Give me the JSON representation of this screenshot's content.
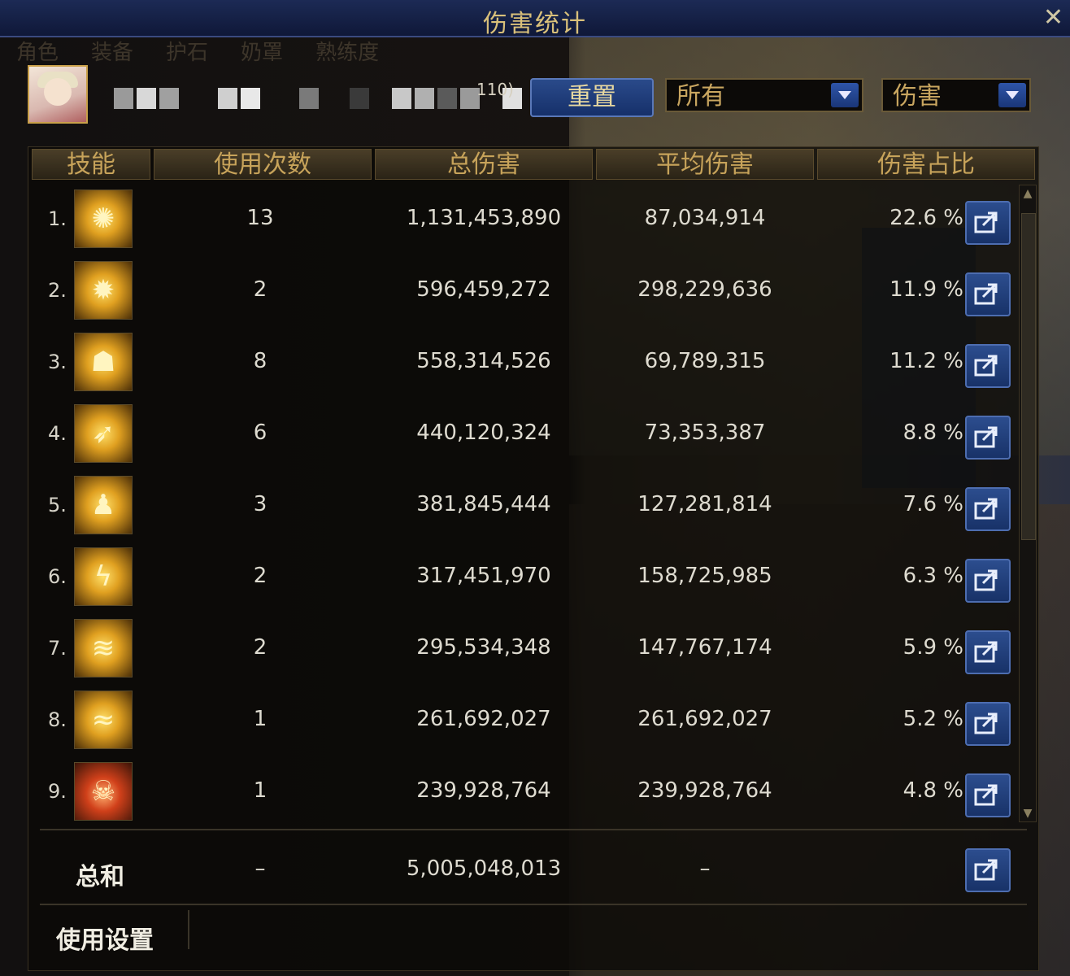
{
  "window": {
    "title": "伤害统计",
    "close_glyph": "✕"
  },
  "background_tabs": [
    "角色",
    "装备",
    "护石",
    "奶罩",
    "熟练度"
  ],
  "player": {
    "suffix": "110)"
  },
  "controls": {
    "reset_label": "重置",
    "filter_target": "所有",
    "filter_type": "伤害"
  },
  "table": {
    "headers": {
      "skill": "技能",
      "count": "使用次数",
      "total": "总伤害",
      "avg": "平均伤害",
      "pct": "伤害占比"
    },
    "rows": [
      {
        "rank": "1.",
        "icon": "fireball-icon",
        "glyph": "✺",
        "count": "13",
        "total": "1,131,453,890",
        "avg": "87,034,914",
        "pct": "22.6 %"
      },
      {
        "rank": "2.",
        "icon": "energy-burst-icon",
        "glyph": "✹",
        "count": "2",
        "total": "596,459,272",
        "avg": "298,229,636",
        "pct": "11.9 %"
      },
      {
        "rank": "3.",
        "icon": "clone-icon",
        "glyph": "☗",
        "count": "8",
        "total": "558,314,526",
        "avg": "69,789,315",
        "pct": "11.2 %"
      },
      {
        "rank": "4.",
        "icon": "bird-strike-icon",
        "glyph": "➶",
        "count": "6",
        "total": "440,120,324",
        "avg": "73,353,387",
        "pct": "8.8 %"
      },
      {
        "rank": "5.",
        "icon": "aura-body-icon",
        "glyph": "♟",
        "count": "3",
        "total": "381,845,444",
        "avg": "127,281,814",
        "pct": "7.6 %"
      },
      {
        "rank": "6.",
        "icon": "lightning-blast-icon",
        "glyph": "ϟ",
        "count": "2",
        "total": "317,451,970",
        "avg": "158,725,985",
        "pct": "6.3 %"
      },
      {
        "rank": "7.",
        "icon": "dragon-roar-icon",
        "glyph": "≋",
        "count": "2",
        "total": "295,534,348",
        "avg": "147,767,174",
        "pct": "5.9 %"
      },
      {
        "rank": "8.",
        "icon": "slash-wave-icon",
        "glyph": "≈",
        "count": "1",
        "total": "261,692,027",
        "avg": "261,692,027",
        "pct": "5.2 %"
      },
      {
        "rank": "9.",
        "icon": "demon-face-icon",
        "glyph": "☠",
        "count": "1",
        "total": "239,928,764",
        "avg": "239,928,764",
        "pct": "4.8 %"
      }
    ],
    "summary": {
      "label": "总和",
      "count": "–",
      "total": "5,005,048,013",
      "avg": "–"
    }
  },
  "footer": {
    "settings_label": "使用设置"
  },
  "colors": {
    "header_gold": "#c7a35a",
    "button_blue": "#2a4a8a",
    "text": "#dedbd0"
  }
}
